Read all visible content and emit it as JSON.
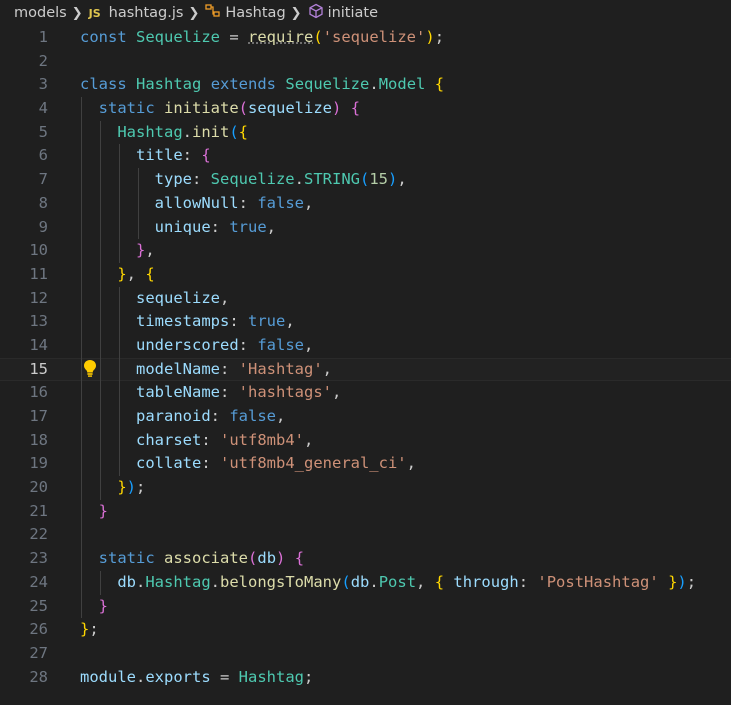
{
  "breadcrumb": {
    "folder": "models",
    "file_badge": "JS",
    "file": "hashtag.js",
    "class_symbol": "Hashtag",
    "method_symbol": "initiate"
  },
  "editor": {
    "current_line": 15,
    "colors": {
      "keyword": "#569cd6",
      "class": "#4ec9b0",
      "variable": "#9cdcfe",
      "function": "#dcdcaa",
      "string": "#ce9178",
      "number": "#b5cea8",
      "bracket1": "#ffd700",
      "bracket2": "#da70d6",
      "bracket3": "#179fff"
    },
    "lines": [
      {
        "n": "1",
        "tokens": [
          [
            "kw",
            "const"
          ],
          [
            "pun",
            " "
          ],
          [
            "cls",
            "Sequelize"
          ],
          [
            "pun",
            " = "
          ],
          [
            "fn",
            "require"
          ],
          [
            "b1",
            "("
          ],
          [
            "str",
            "'sequelize'"
          ],
          [
            "b1",
            ")"
          ],
          [
            "pun",
            ";"
          ]
        ]
      },
      {
        "n": "2",
        "tokens": []
      },
      {
        "n": "3",
        "tokens": [
          [
            "kw",
            "class"
          ],
          [
            "pun",
            " "
          ],
          [
            "cls",
            "Hashtag"
          ],
          [
            "pun",
            " "
          ],
          [
            "kw",
            "extends"
          ],
          [
            "pun",
            " "
          ],
          [
            "cls",
            "Sequelize"
          ],
          [
            "pun",
            "."
          ],
          [
            "cls",
            "Model"
          ],
          [
            "pun",
            " "
          ],
          [
            "b1",
            "{"
          ]
        ]
      },
      {
        "n": "4",
        "tokens": [
          [
            "pun",
            "  "
          ],
          [
            "kw",
            "static"
          ],
          [
            "pun",
            " "
          ],
          [
            "fn",
            "initiate"
          ],
          [
            "b2",
            "("
          ],
          [
            "var",
            "sequelize"
          ],
          [
            "b2",
            ")"
          ],
          [
            "pun",
            " "
          ],
          [
            "b2",
            "{"
          ]
        ]
      },
      {
        "n": "5",
        "tokens": [
          [
            "pun",
            "    "
          ],
          [
            "cls",
            "Hashtag"
          ],
          [
            "pun",
            "."
          ],
          [
            "fn",
            "init"
          ],
          [
            "b3",
            "("
          ],
          [
            "b1",
            "{"
          ]
        ]
      },
      {
        "n": "6",
        "tokens": [
          [
            "pun",
            "      "
          ],
          [
            "var",
            "title"
          ],
          [
            "pun",
            ": "
          ],
          [
            "b2",
            "{"
          ]
        ]
      },
      {
        "n": "7",
        "tokens": [
          [
            "pun",
            "        "
          ],
          [
            "var",
            "type"
          ],
          [
            "pun",
            ": "
          ],
          [
            "cls",
            "Sequelize"
          ],
          [
            "pun",
            "."
          ],
          [
            "cls",
            "STRING"
          ],
          [
            "b3",
            "("
          ],
          [
            "num",
            "15"
          ],
          [
            "b3",
            ")"
          ],
          [
            "pun",
            ","
          ]
        ]
      },
      {
        "n": "8",
        "tokens": [
          [
            "pun",
            "        "
          ],
          [
            "var",
            "allowNull"
          ],
          [
            "pun",
            ": "
          ],
          [
            "kw",
            "false"
          ],
          [
            "pun",
            ","
          ]
        ]
      },
      {
        "n": "9",
        "tokens": [
          [
            "pun",
            "        "
          ],
          [
            "var",
            "unique"
          ],
          [
            "pun",
            ": "
          ],
          [
            "kw",
            "true"
          ],
          [
            "pun",
            ","
          ]
        ]
      },
      {
        "n": "10",
        "tokens": [
          [
            "pun",
            "      "
          ],
          [
            "b2",
            "}"
          ],
          [
            "pun",
            ","
          ]
        ]
      },
      {
        "n": "11",
        "tokens": [
          [
            "pun",
            "    "
          ],
          [
            "b1",
            "}"
          ],
          [
            "pun",
            ", "
          ],
          [
            "b1",
            "{"
          ]
        ]
      },
      {
        "n": "12",
        "tokens": [
          [
            "pun",
            "      "
          ],
          [
            "var",
            "sequelize"
          ],
          [
            "pun",
            ","
          ]
        ]
      },
      {
        "n": "13",
        "tokens": [
          [
            "pun",
            "      "
          ],
          [
            "var",
            "timestamps"
          ],
          [
            "pun",
            ": "
          ],
          [
            "kw",
            "true"
          ],
          [
            "pun",
            ","
          ]
        ]
      },
      {
        "n": "14",
        "tokens": [
          [
            "pun",
            "      "
          ],
          [
            "var",
            "underscored"
          ],
          [
            "pun",
            ": "
          ],
          [
            "kw",
            "false"
          ],
          [
            "pun",
            ","
          ]
        ]
      },
      {
        "n": "15",
        "tokens": [
          [
            "pun",
            "      "
          ],
          [
            "var",
            "modelName"
          ],
          [
            "pun",
            ": "
          ],
          [
            "str",
            "'Hashtag'"
          ],
          [
            "pun",
            ","
          ]
        ]
      },
      {
        "n": "16",
        "tokens": [
          [
            "pun",
            "      "
          ],
          [
            "var",
            "tableName"
          ],
          [
            "pun",
            ": "
          ],
          [
            "str",
            "'hashtags'"
          ],
          [
            "pun",
            ","
          ]
        ]
      },
      {
        "n": "17",
        "tokens": [
          [
            "pun",
            "      "
          ],
          [
            "var",
            "paranoid"
          ],
          [
            "pun",
            ": "
          ],
          [
            "kw",
            "false"
          ],
          [
            "pun",
            ","
          ]
        ]
      },
      {
        "n": "18",
        "tokens": [
          [
            "pun",
            "      "
          ],
          [
            "var",
            "charset"
          ],
          [
            "pun",
            ": "
          ],
          [
            "str",
            "'utf8mb4'"
          ],
          [
            "pun",
            ","
          ]
        ]
      },
      {
        "n": "19",
        "tokens": [
          [
            "pun",
            "      "
          ],
          [
            "var",
            "collate"
          ],
          [
            "pun",
            ": "
          ],
          [
            "str",
            "'utf8mb4_general_ci'"
          ],
          [
            "pun",
            ","
          ]
        ]
      },
      {
        "n": "20",
        "tokens": [
          [
            "pun",
            "    "
          ],
          [
            "b1",
            "}"
          ],
          [
            "b3",
            ")"
          ],
          [
            "pun",
            ";"
          ]
        ]
      },
      {
        "n": "21",
        "tokens": [
          [
            "pun",
            "  "
          ],
          [
            "b2",
            "}"
          ]
        ]
      },
      {
        "n": "22",
        "tokens": []
      },
      {
        "n": "23",
        "tokens": [
          [
            "pun",
            "  "
          ],
          [
            "kw",
            "static"
          ],
          [
            "pun",
            " "
          ],
          [
            "fn",
            "associate"
          ],
          [
            "b2",
            "("
          ],
          [
            "var",
            "db"
          ],
          [
            "b2",
            ")"
          ],
          [
            "pun",
            " "
          ],
          [
            "b2",
            "{"
          ]
        ]
      },
      {
        "n": "24",
        "tokens": [
          [
            "pun",
            "    "
          ],
          [
            "var",
            "db"
          ],
          [
            "pun",
            "."
          ],
          [
            "cls",
            "Hashtag"
          ],
          [
            "pun",
            "."
          ],
          [
            "fn",
            "belongsToMany"
          ],
          [
            "b3",
            "("
          ],
          [
            "var",
            "db"
          ],
          [
            "pun",
            "."
          ],
          [
            "cls",
            "Post"
          ],
          [
            "pun",
            ", "
          ],
          [
            "b1",
            "{"
          ],
          [
            "pun",
            " "
          ],
          [
            "var",
            "through"
          ],
          [
            "pun",
            ": "
          ],
          [
            "str",
            "'PostHashtag'"
          ],
          [
            "pun",
            " "
          ],
          [
            "b1",
            "}"
          ],
          [
            "b3",
            ")"
          ],
          [
            "pun",
            ";"
          ]
        ]
      },
      {
        "n": "25",
        "tokens": [
          [
            "pun",
            "  "
          ],
          [
            "b2",
            "}"
          ]
        ]
      },
      {
        "n": "26",
        "tokens": [
          [
            "b1",
            "}"
          ],
          [
            "pun",
            ";"
          ]
        ]
      },
      {
        "n": "27",
        "tokens": []
      },
      {
        "n": "28",
        "tokens": [
          [
            "var",
            "module"
          ],
          [
            "pun",
            "."
          ],
          [
            "var",
            "exports"
          ],
          [
            "pun",
            " = "
          ],
          [
            "cls",
            "Hashtag"
          ],
          [
            "pun",
            ";"
          ]
        ]
      }
    ]
  }
}
